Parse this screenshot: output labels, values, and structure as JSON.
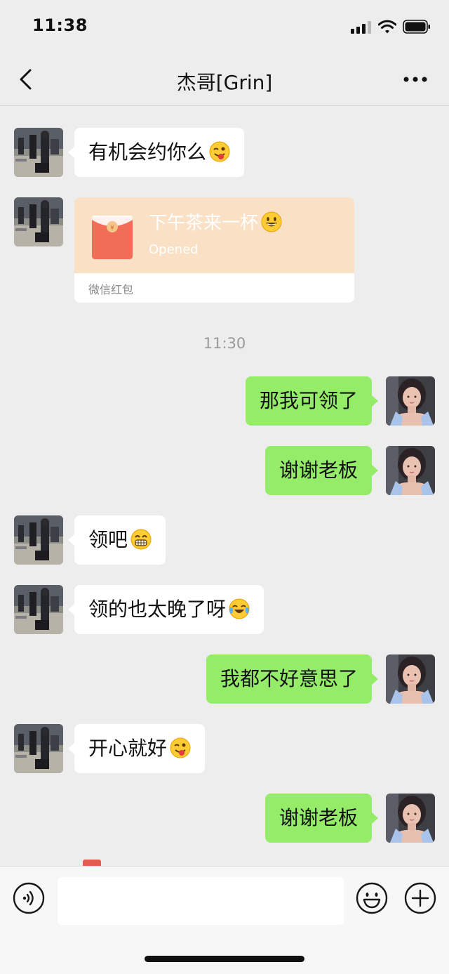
{
  "status_bar": {
    "time": "11:38"
  },
  "header": {
    "title": "杰哥[Grin]"
  },
  "messages": [
    {
      "text": "有机会约你么"
    },
    {
      "red_packet_greeting": "下午茶来一杯",
      "red_packet_status": "Opened",
      "red_packet_label": "微信红包"
    },
    {
      "timestamp": "11:30"
    },
    {
      "text": "那我可领了"
    },
    {
      "text": "谢谢老板"
    },
    {
      "text": "领吧"
    },
    {
      "text": "领的也太晚了呀"
    },
    {
      "text": "我都不好意思了"
    },
    {
      "text": "开心就好"
    },
    {
      "text": "谢谢老板"
    }
  ],
  "icons": {
    "back": "chevron-left-icon",
    "more": "more-icon",
    "voice": "voice-icon",
    "emoji": "emoji-icon",
    "plus": "plus-icon"
  },
  "colors": {
    "background": "#ededed",
    "sent_bubble": "#95ec69",
    "received_bubble": "#ffffff",
    "red_packet": "#fae1c6"
  }
}
